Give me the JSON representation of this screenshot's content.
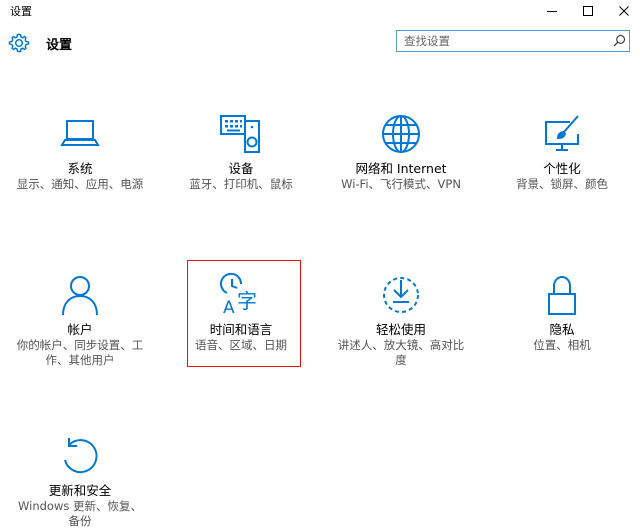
{
  "window": {
    "title": "设置"
  },
  "header": {
    "title": "设置",
    "search_placeholder": "查找设置"
  },
  "tiles": [
    {
      "name": "系统",
      "desc": "显示、通知、应用、电源",
      "icon": "laptop-icon"
    },
    {
      "name": "设备",
      "desc": "蓝牙、打印机、鼠标",
      "icon": "devices-icon"
    },
    {
      "name": "网络和 Internet",
      "desc": "Wi-Fi、飞行模式、VPN",
      "icon": "globe-icon"
    },
    {
      "name": "个性化",
      "desc": "背景、锁屏、颜色",
      "icon": "personalization-icon"
    },
    {
      "name": "帐户",
      "desc": "你的帐户、同步设置、工作、其他用户",
      "icon": "person-icon"
    },
    {
      "name": "时间和语言",
      "desc": "语音、区域、日期",
      "icon": "time-language-icon",
      "highlighted": true
    },
    {
      "name": "轻松使用",
      "desc": "讲述人、放大镜、高对比度",
      "icon": "ease-of-access-icon"
    },
    {
      "name": "隐私",
      "desc": "位置、相机",
      "icon": "lock-icon"
    },
    {
      "name": "更新和安全",
      "desc": "Windows 更新、恢复、备份",
      "icon": "update-icon"
    }
  ],
  "colors": {
    "accent": "#0078d7",
    "highlight_box": "#e0140c"
  }
}
